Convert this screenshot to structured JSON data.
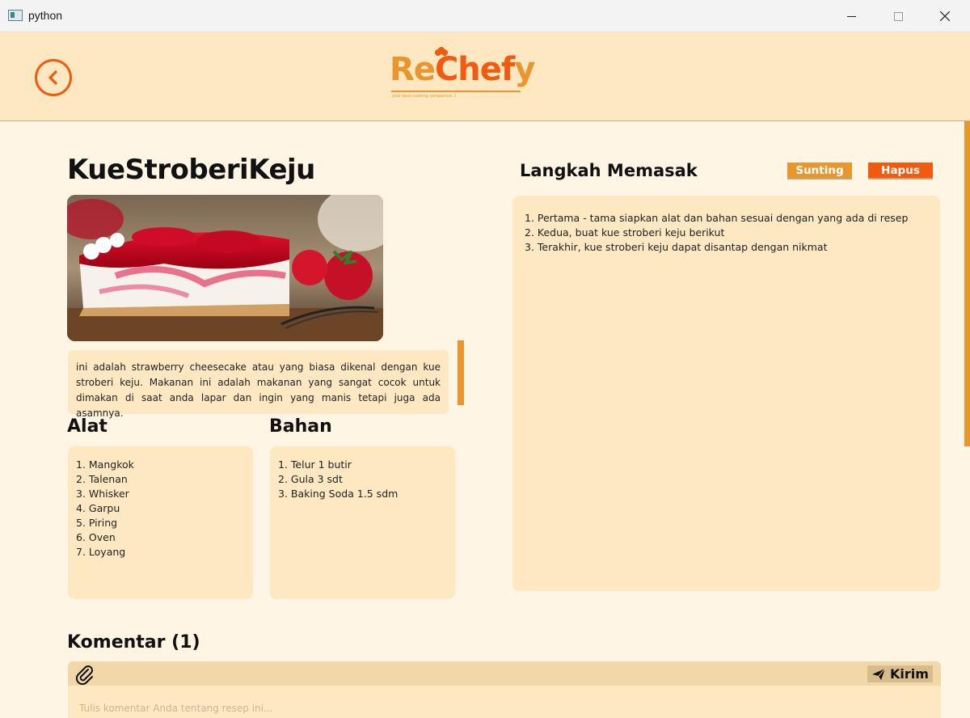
{
  "window": {
    "title": "python"
  },
  "header": {
    "logo": {
      "re": "Re",
      "chef": "Chef",
      "fy": "y",
      "tagline": "your best cooking companion :)"
    }
  },
  "recipe": {
    "title": "KueStroberiKeju",
    "description": "ini adalah strawberry cheesecake atau yang biasa dikenal dengan kue stroberi keju. Makanan ini adalah makanan yang sangat cocok untuk dimakan di saat anda lapar dan ingin yang manis tetapi juga ada asamnya.",
    "tools_heading": "Alat",
    "tools": [
      "1. Mangkok",
      "2. Talenan",
      "3. Whisker",
      "4. Garpu",
      "5. Piring",
      "6. Oven",
      "7. Loyang"
    ],
    "ingredients_heading": "Bahan",
    "ingredients": [
      "1. Telur 1 butir",
      "2. Gula 3 sdt",
      "3. Baking Soda 1.5 sdm"
    ]
  },
  "steps": {
    "heading": "Langkah Memasak",
    "edit_label": "Sunting",
    "delete_label": "Hapus",
    "items": [
      "1. Pertama - tama siapkan alat dan bahan sesuai dengan yang ada di resep",
      "2. Kedua, buat kue stroberi keju berikut",
      "3. Terakhir, kue stroberi keju dapat disantap dengan nikmat"
    ]
  },
  "comments": {
    "heading": "Komentar (1)",
    "send_label": "Kirim",
    "placeholder": "Tulis komentar Anda tentang resep ini..."
  },
  "colors": {
    "accent_orange": "#E9962E",
    "accent_red": "#F05A11",
    "header_bg": "#FDE8C2",
    "page_bg": "#FFF5E4"
  }
}
